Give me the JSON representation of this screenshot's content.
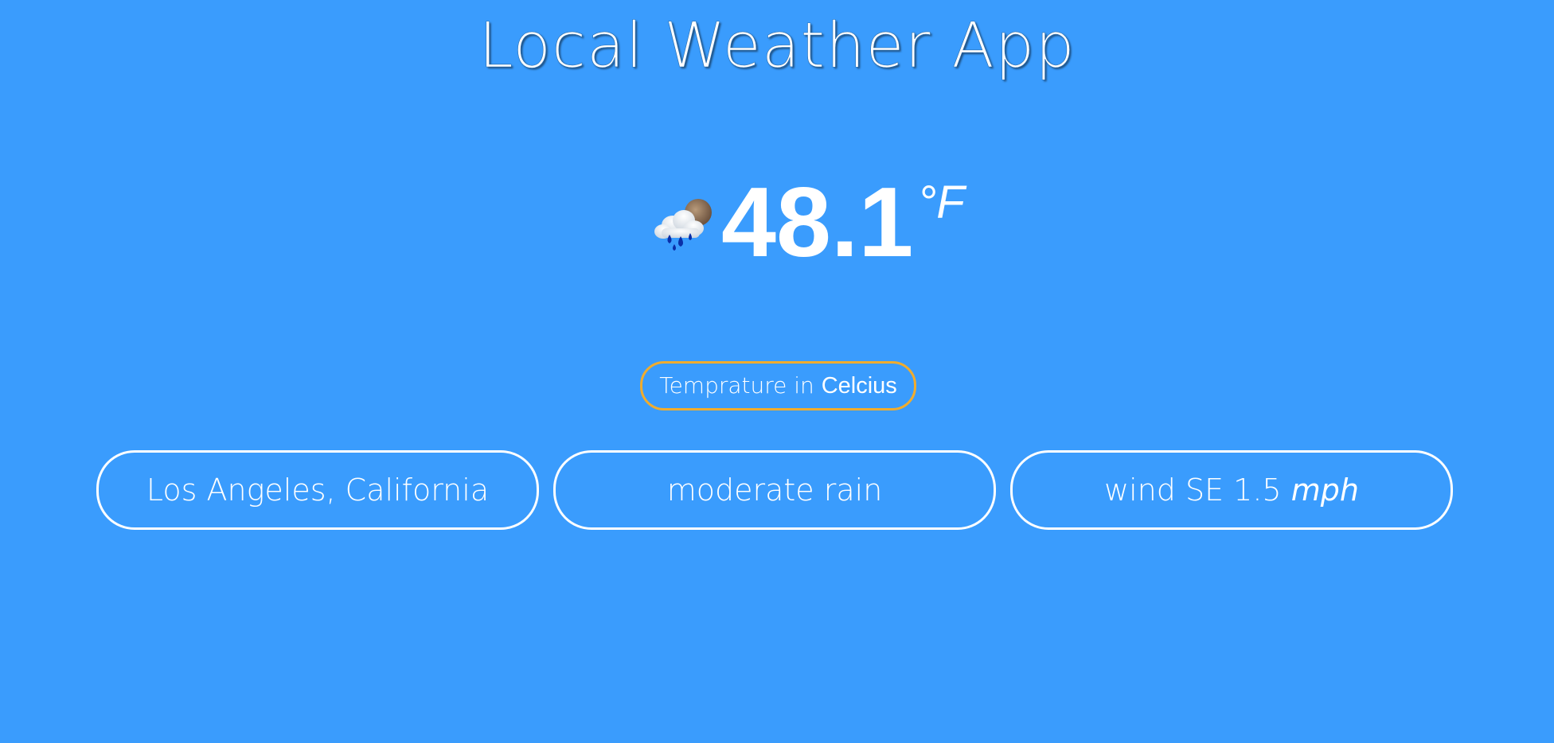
{
  "app": {
    "title": "Local Weather App"
  },
  "current": {
    "icon": "moderate-rain-cloud-icon",
    "temperature": "48.1",
    "unit_symbol": "°F"
  },
  "toggle": {
    "prefix": "Temprature in ",
    "unit_word": "Celcius"
  },
  "info": {
    "location": "Los Angeles, California",
    "condition": "moderate rain",
    "wind_text": "wind SE 1.5 ",
    "wind_unit": "mph"
  },
  "colors": {
    "background": "#3a9cfd",
    "toggle_border": "#f0ac2e",
    "pill_border": "#ffffff"
  }
}
